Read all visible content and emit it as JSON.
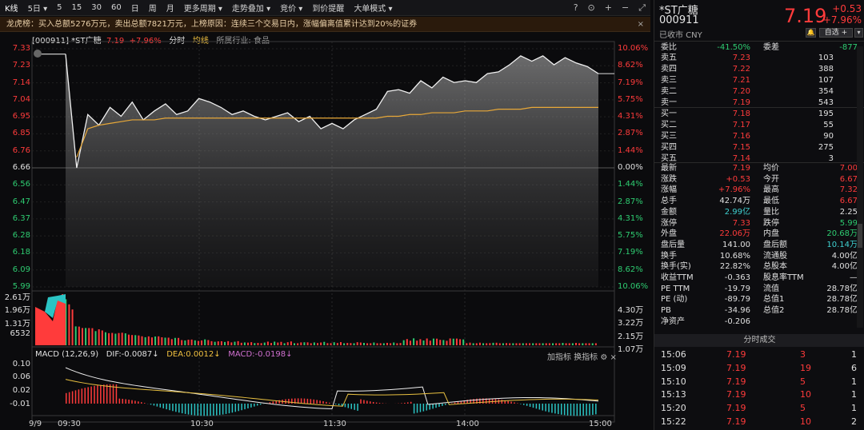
{
  "toolbar": {
    "items": [
      "K线",
      "5日 ▾",
      "5",
      "15",
      "30",
      "60",
      "日",
      "周",
      "月",
      "更多周期 ▾",
      "走势叠加 ▾",
      "竞价 ▾",
      "到价提醒",
      "大单模式 ▾"
    ]
  },
  "banner": {
    "text": "龙虎榜：买入总额5276万元，卖出总额7821万元，上榜原因：连续三个交易日内，涨幅偏离值累计达到20%的证券",
    "close": "×"
  },
  "chart_info": {
    "code": "[000911] *ST广糖",
    "price": "7.19",
    "pct": "+7.96%",
    "mode": "分时",
    "avg": "均线",
    "industry": "所属行业: 食品"
  },
  "price_axis": [
    "7.33",
    "7.23",
    "7.14",
    "7.04",
    "6.95",
    "6.85",
    "6.76",
    "6.66",
    "6.56",
    "6.47",
    "6.37",
    "6.28",
    "6.18",
    "6.09",
    "5.99"
  ],
  "pct_axis": [
    "10.06%",
    "8.62%",
    "7.19%",
    "5.75%",
    "4.31%",
    "2.87%",
    "1.44%",
    "0.00%",
    "1.44%",
    "2.87%",
    "4.31%",
    "5.75%",
    "7.19%",
    "8.62%",
    "10.06%"
  ],
  "vol_axis_left": [
    "2.61万",
    "1.96万",
    "1.31万",
    "6532"
  ],
  "vol_axis_right": [
    "4.30万",
    "3.22万",
    "2.15万",
    "1.07万"
  ],
  "macd_axis": [
    "0.10",
    "0.06",
    "0.02",
    "-0.01"
  ],
  "macd_info": {
    "name": "MACD (12,26,9)",
    "dif": "DIF:-0.0087↓",
    "dea": "DEA:0.0012↓",
    "macd": "MACD:-0.0198↓",
    "btn1": "加指标",
    "btn2": "换指标"
  },
  "time_axis": {
    "date": "9/9",
    "t1": "09:30",
    "t2": "10:30",
    "t3": "11:30",
    "t4": "14:00",
    "t5": "15:00"
  },
  "chart_data": {
    "type": "line",
    "prev_close": 6.66,
    "ylim": [
      5.99,
      7.33
    ],
    "x": [
      "09:30",
      "09:35",
      "09:40",
      "09:45",
      "09:50",
      "09:55",
      "10:00",
      "10:05",
      "10:10",
      "10:15",
      "10:20",
      "10:25",
      "10:30",
      "10:35",
      "10:40",
      "10:45",
      "10:50",
      "10:55",
      "11:00",
      "11:05",
      "11:10",
      "11:15",
      "11:20",
      "11:25",
      "11:30",
      "13:05",
      "13:10",
      "13:15",
      "13:20",
      "13:25",
      "13:30",
      "13:35",
      "13:40",
      "13:45",
      "13:50",
      "13:55",
      "14:00",
      "14:05",
      "14:10",
      "14:15",
      "14:20",
      "14:25",
      "14:30",
      "14:35",
      "14:40",
      "14:45",
      "14:50",
      "14:55",
      "15:00"
    ],
    "series": [
      {
        "values": [
          7.3,
          6.66,
          6.96,
          6.9,
          7.0,
          6.95,
          7.03,
          6.93,
          6.98,
          7.02,
          6.96,
          6.98,
          7.05,
          7.03,
          7.0,
          6.96,
          6.98,
          6.95,
          6.93,
          6.95,
          6.97,
          6.92,
          6.95,
          6.88,
          6.91,
          6.88,
          6.93,
          6.96,
          6.99,
          7.09,
          7.1,
          7.08,
          7.15,
          7.11,
          7.17,
          7.14,
          7.15,
          7.14,
          7.19,
          7.2,
          7.24,
          7.29,
          7.26,
          7.29,
          7.24,
          7.28,
          7.25,
          7.23,
          7.19
        ]
      },
      {
        "values": [
          null,
          6.72,
          6.88,
          6.9,
          6.91,
          6.92,
          6.93,
          6.93,
          6.93,
          6.94,
          6.94,
          6.94,
          6.94,
          6.94,
          6.94,
          6.94,
          6.94,
          6.94,
          6.94,
          6.94,
          6.94,
          6.94,
          6.94,
          6.94,
          6.94,
          6.94,
          6.94,
          6.94,
          6.94,
          6.95,
          6.95,
          6.96,
          6.96,
          6.97,
          6.97,
          6.97,
          6.98,
          6.98,
          6.98,
          6.99,
          6.99,
          6.99,
          7.0,
          7.0,
          7.0,
          7.0,
          7.0,
          7.0,
          7.0
        ]
      }
    ]
  },
  "stock": {
    "name": "*ST广糖",
    "code": "000911",
    "status": "已收市 CNY",
    "price": "7.19",
    "change": "+0.53",
    "pct": "+7.96%",
    "bell": "🔔",
    "fav": "自选 +",
    "more": "▾"
  },
  "weibi": {
    "l1": "委比",
    "v1": "-41.50%",
    "l2": "委差",
    "v2": "-877"
  },
  "asks": [
    {
      "l": "卖五",
      "p": "7.23",
      "v": "103"
    },
    {
      "l": "卖四",
      "p": "7.22",
      "v": "388"
    },
    {
      "l": "卖三",
      "p": "7.21",
      "v": "107"
    },
    {
      "l": "卖二",
      "p": "7.20",
      "v": "354"
    },
    {
      "l": "卖一",
      "p": "7.19",
      "v": "543"
    }
  ],
  "bids": [
    {
      "l": "买一",
      "p": "7.18",
      "v": "195"
    },
    {
      "l": "买二",
      "p": "7.17",
      "v": "55"
    },
    {
      "l": "买三",
      "p": "7.16",
      "v": "90"
    },
    {
      "l": "买四",
      "p": "7.15",
      "v": "275"
    },
    {
      "l": "买五",
      "p": "7.14",
      "v": "3"
    }
  ],
  "stats": [
    {
      "l1": "最新",
      "v1": "7.19",
      "c1": "red",
      "l2": "均价",
      "v2": "7.00",
      "c2": "red"
    },
    {
      "l1": "涨跌",
      "v1": "+0.53",
      "c1": "red",
      "l2": "今开",
      "v2": "6.67",
      "c2": "red"
    },
    {
      "l1": "涨幅",
      "v1": "+7.96%",
      "c1": "red",
      "l2": "最高",
      "v2": "7.32",
      "c2": "red"
    },
    {
      "l1": "总手",
      "v1": "42.74万",
      "c1": "white",
      "l2": "最低",
      "v2": "6.67",
      "c2": "red"
    },
    {
      "l1": "金额",
      "v1": "2.99亿",
      "c1": "cyan",
      "l2": "量比",
      "v2": "2.25",
      "c2": "white"
    },
    {
      "l1": "涨停",
      "v1": "7.33",
      "c1": "red",
      "l2": "跌停",
      "v2": "5.99",
      "c2": "green"
    },
    {
      "l1": "外盘",
      "v1": "22.06万",
      "c1": "red",
      "l2": "内盘",
      "v2": "20.68万",
      "c2": "green"
    },
    {
      "l1": "盘后量",
      "v1": "141.00",
      "c1": "white",
      "l2": "盘后额",
      "v2": "10.14万",
      "c2": "cyan"
    },
    {
      "l1": "换手",
      "v1": "10.68%",
      "c1": "white",
      "l2": "流通股",
      "v2": "4.00亿",
      "c2": "white"
    },
    {
      "l1": "换手(实)",
      "v1": "22.82%",
      "c1": "white",
      "l2": "总股本",
      "v2": "4.00亿",
      "c2": "white"
    },
    {
      "l1": "收益TTM",
      "v1": "-0.363",
      "c1": "white",
      "l2": "股息率TTM",
      "v2": "—",
      "c2": "white"
    },
    {
      "l1": "PE TTM",
      "v1": "-19.79",
      "c1": "white",
      "l2": "流值",
      "v2": "28.78亿",
      "c2": "white"
    },
    {
      "l1": "PE (动)",
      "v1": "-89.79",
      "c1": "white",
      "l2": "总值1",
      "v2": "28.78亿",
      "c2": "white"
    },
    {
      "l1": "PB",
      "v1": "-34.96",
      "c1": "white",
      "l2": "总值2",
      "v2": "28.78亿",
      "c2": "white"
    },
    {
      "l1": "净资产",
      "v1": "-0.206",
      "c1": "white",
      "l2": "",
      "v2": "",
      "c2": "white"
    }
  ],
  "trades_title": "分时成交",
  "trades": [
    {
      "t": "15:06",
      "p": "7.19",
      "v": "3",
      "n": "1"
    },
    {
      "t": "15:09",
      "p": "7.19",
      "v": "19",
      "n": "6"
    },
    {
      "t": "15:10",
      "p": "7.19",
      "v": "5",
      "n": "1"
    },
    {
      "t": "15:13",
      "p": "7.19",
      "v": "10",
      "n": "1"
    },
    {
      "t": "15:20",
      "p": "7.19",
      "v": "5",
      "n": "1"
    },
    {
      "t": "15:22",
      "p": "7.19",
      "v": "10",
      "n": "2"
    }
  ]
}
